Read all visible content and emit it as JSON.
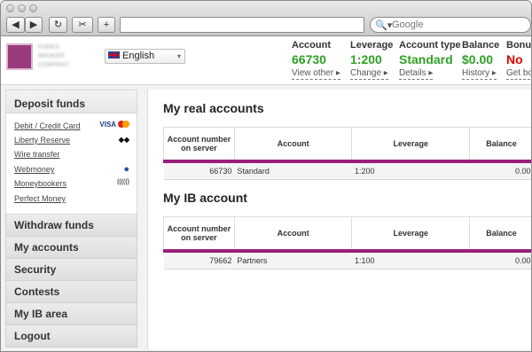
{
  "browser": {
    "back_glyph": "◀",
    "forward_glyph": "▶",
    "reload_glyph": "↻",
    "clip_glyph": "✂",
    "add_glyph": "+",
    "search_placeholder": "Google",
    "search_glyph": "🔍▾"
  },
  "header": {
    "logo_text": "FOREX BROKER COMPANY",
    "language": "English",
    "stats": [
      {
        "label": "Account",
        "value": "66730",
        "link": "View other ▸",
        "color": "#2fa025"
      },
      {
        "label": "Leverage",
        "value": "1:200",
        "link": "Change ▸",
        "color": "#2fa025"
      },
      {
        "label": "Account type",
        "value": "Standard",
        "link": "Details ▸",
        "color": "#2fa025"
      },
      {
        "label": "Balance",
        "value": "$0.00",
        "link": "History ▸",
        "color": "#2fa025"
      },
      {
        "label": "Bonus",
        "value": "No",
        "link": "Get bonus",
        "color": "#e10000"
      }
    ]
  },
  "sidebar": {
    "deposit_title": "Deposit funds",
    "payment_methods": [
      {
        "label": "Debit / Credit Card",
        "icon": "visa-mastercard-icon"
      },
      {
        "label": "Liberty Reserve",
        "icon": "liberty-reserve-icon"
      },
      {
        "label": "Wire transfer",
        "icon": ""
      },
      {
        "label": "Webmoney",
        "icon": "webmoney-icon"
      },
      {
        "label": "Moneybookers",
        "icon": "moneybookers-icon"
      },
      {
        "label": "Perfect Money",
        "icon": ""
      }
    ],
    "nav": [
      "Withdraw funds",
      "My accounts",
      "Security",
      "Contests",
      "My IB area",
      "Logout"
    ],
    "visa_text": "VISA"
  },
  "main": {
    "real_title": "My real accounts",
    "ib_title": "My IB account",
    "columns": [
      "Account number on server",
      "Account",
      "Leverage",
      "Balance"
    ],
    "real_rows": [
      [
        "66730",
        "Standard",
        "1:200",
        "0.00"
      ]
    ],
    "ib_rows": [
      [
        "79662",
        "Partners",
        "1:100",
        "0.00"
      ]
    ],
    "accent": "#9a1f78"
  }
}
